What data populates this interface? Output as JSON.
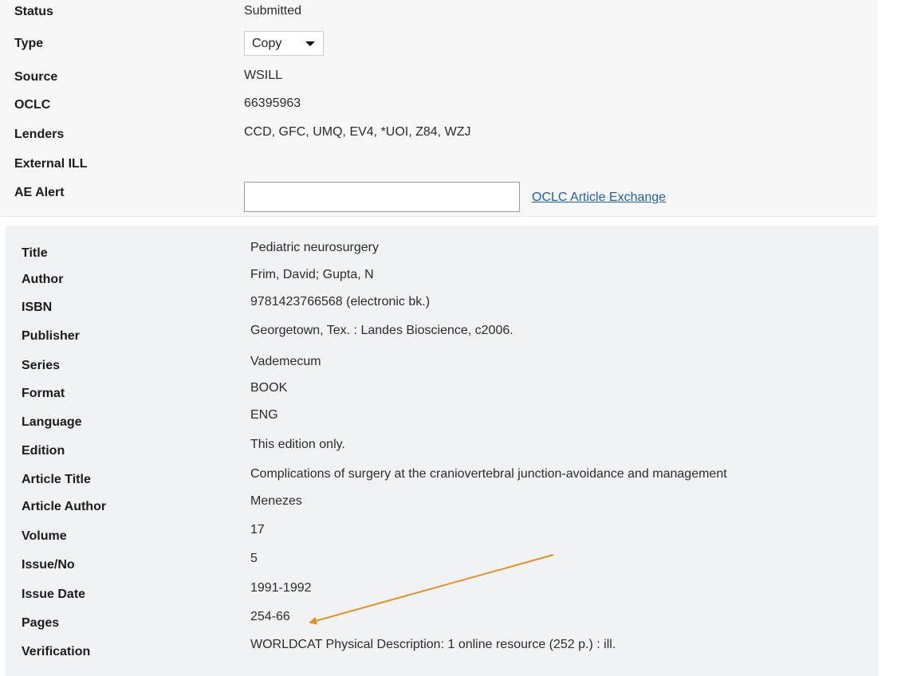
{
  "request": {
    "status": {
      "label": "Status",
      "value": "Submitted"
    },
    "type": {
      "label": "Type",
      "selected": "Copy"
    },
    "source": {
      "label": "Source",
      "value": "WSILL"
    },
    "oclc": {
      "label": "OCLC",
      "value": "66395963"
    },
    "lenders": {
      "label": "Lenders",
      "value": "CCD, GFC, UMQ, EV4, *UOI, Z84, WZJ"
    },
    "external_ill": {
      "label": "External ILL",
      "value": ""
    },
    "ae_alert": {
      "label": "AE Alert",
      "input_value": "",
      "link_label": "OCLC Article Exchange"
    }
  },
  "bibliographic": {
    "title": {
      "label": "Title",
      "value": "Pediatric neurosurgery"
    },
    "author": {
      "label": "Author",
      "value": "Frim, David; Gupta, N"
    },
    "isbn": {
      "label": "ISBN",
      "value": "9781423766568 (electronic bk.)"
    },
    "publisher": {
      "label": "Publisher",
      "value": "Georgetown, Tex. : Landes Bioscience, c2006."
    },
    "series": {
      "label": "Series",
      "value": "Vademecum"
    },
    "format": {
      "label": "Format",
      "value": "BOOK"
    },
    "language": {
      "label": "Language",
      "value": "ENG"
    },
    "edition": {
      "label": "Edition",
      "value": "This edition only."
    },
    "article_title": {
      "label": "Article Title",
      "value": "Complications of surgery at the craniovertebral junction-avoidance and management"
    },
    "article_author": {
      "label": "Article Author",
      "value": "Menezes"
    },
    "volume": {
      "label": "Volume",
      "value": "17"
    },
    "issue_no": {
      "label": "Issue/No",
      "value": "5"
    },
    "issue_date": {
      "label": "Issue Date",
      "value": "1991-1992"
    },
    "pages": {
      "label": "Pages",
      "value": "254-66"
    },
    "verification": {
      "label": "Verification",
      "value": "WORLDCAT Physical Description: 1 online resource (252 p.) : ill."
    }
  },
  "annotation": {
    "arrow_color": "#e8901c",
    "target": "pages"
  },
  "colors": {
    "link": "#1e5fa8",
    "panel_background": "#f0f3f6"
  }
}
